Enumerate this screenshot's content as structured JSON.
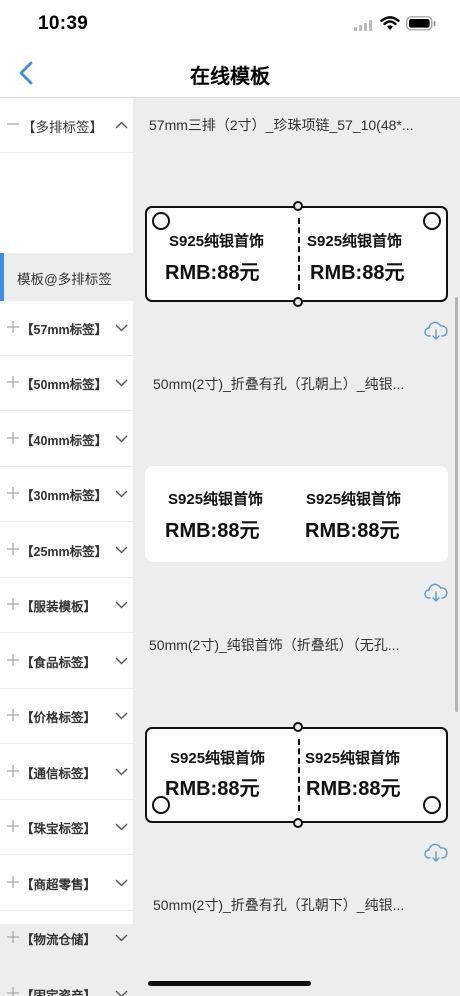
{
  "status": {
    "time": "10:39"
  },
  "nav": {
    "title": "在线模板"
  },
  "sidebar": {
    "categories": [
      {
        "label": "【多排标签】"
      },
      {
        "label": "【57mm标签】"
      },
      {
        "label": "【50mm标签】"
      },
      {
        "label": "【40mm标签】"
      },
      {
        "label": "【30mm标签】"
      },
      {
        "label": "【25mm标签】"
      },
      {
        "label": "【服装模板】"
      },
      {
        "label": "【食品标签】"
      },
      {
        "label": "【价格标签】"
      },
      {
        "label": "【通信标签】"
      },
      {
        "label": "【珠宝标签】"
      },
      {
        "label": "【商超零售】"
      },
      {
        "label": "【物流仓储】"
      },
      {
        "label": "【固定资产】"
      }
    ],
    "selected_sub": "模板@多排标签"
  },
  "templates": [
    {
      "title": "57mm三排（2寸）_珍珠项链_57_10(48*...",
      "line1": "S925纯银首饰",
      "line2": "RMB:88元"
    },
    {
      "title": "50mm(2寸)_折叠有孔（孔朝上）_纯银...",
      "line1": "S925纯银首饰",
      "line2": "RMB:88元"
    },
    {
      "title": "50mm(2寸)_纯银首饰（折叠纸）（无孔...",
      "line1": "S925纯银首饰",
      "line2": "RMB:88元"
    },
    {
      "title": "50mm(2寸)_折叠有孔（孔朝下）_纯银...",
      "line1": "S925纯银首饰",
      "line2": "RMB:88元"
    }
  ],
  "colors": {
    "accent": "#3c8ee6",
    "download_icon": "#5b9bd8"
  }
}
